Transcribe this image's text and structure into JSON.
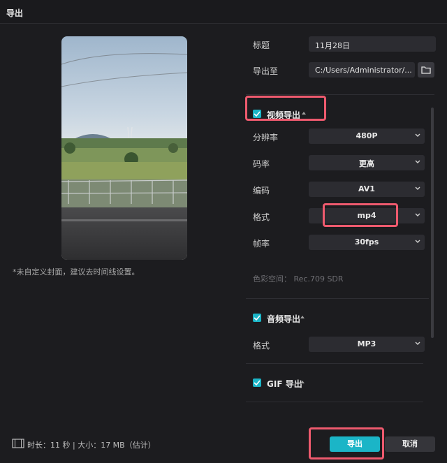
{
  "window": {
    "title": "导出"
  },
  "preview": {
    "cover_note": "*未自定义封面，建议去时间线设置。"
  },
  "form": {
    "title_label": "标题",
    "title_value": "11月28日",
    "export_to_label": "导出至",
    "export_to_value": "C:/Users/Administrator/...",
    "folder_icon": "folder-icon"
  },
  "video_export": {
    "label": "视频导出",
    "checked": true,
    "resolution": {
      "label": "分辨率",
      "value": "480P"
    },
    "bitrate": {
      "label": "码率",
      "value": "更高"
    },
    "codec": {
      "label": "编码",
      "value": "AV1"
    },
    "format": {
      "label": "格式",
      "value": "mp4"
    },
    "framerate": {
      "label": "帧率",
      "value": "30fps"
    },
    "color_space_label": "色彩空间：",
    "color_space_value": "Rec.709 SDR"
  },
  "audio_export": {
    "label": "音频导出",
    "checked": true,
    "format": {
      "label": "格式",
      "value": "MP3"
    }
  },
  "gif_export": {
    "label": "GIF 导出",
    "checked": true
  },
  "footer": {
    "info": "时长：11 秒 | 大小：17 MB（估计）",
    "export_button": "导出",
    "cancel_button": "取消"
  },
  "colors": {
    "accent": "#1bb5c7",
    "highlight": "#ee5a6e",
    "background": "#1c1c1f"
  }
}
